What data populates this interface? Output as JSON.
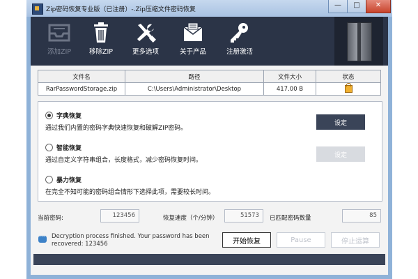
{
  "window": {
    "title": "Zip密码恢复专业版（已注册）-.Zip压缩文件密码恢复"
  },
  "toolbar": {
    "add_label": "添加ZIP",
    "remove_label": "移除ZIP",
    "options_label": "更多选项",
    "about_label": "关于产品",
    "register_label": "注册激活"
  },
  "table": {
    "headers": [
      "文件名",
      "路径",
      "文件大小",
      "状态"
    ],
    "rows": [
      {
        "name": "RarPasswordStorage.zip",
        "path": "C:\\Users\\Administrator\\Desktop",
        "size": "417.00 B",
        "status_icon": "lock-icon"
      }
    ]
  },
  "options": {
    "dict": {
      "title": "字典恢复",
      "desc": "通过我们内置的密码字典快速恢复和破解ZIP密码。",
      "selected": true,
      "button": "设定"
    },
    "smart": {
      "title": "智能恢复",
      "desc": "通过自定义字符串组合，长度格式，减少密码恢复时间。",
      "selected": false,
      "button": "设定"
    },
    "brute": {
      "title": "暴力恢复",
      "desc": "在完全不知可能的密码组合情形下选择此项，需要较长时间。",
      "selected": false
    }
  },
  "stats": {
    "current_label": "当前密码:",
    "current_value": "123456",
    "speed_label": "恢复速度（个/分钟）",
    "speed_value": "51573",
    "matched_label": "已匹配密码数量",
    "matched_value": "85"
  },
  "status": {
    "message": "Decryption process finished. Your password has been recovered: 123456"
  },
  "actions": {
    "start": "开始恢复",
    "pause": "Pause",
    "stop": "停止运算"
  },
  "progress": {
    "fraction": 1.0
  },
  "colors": {
    "toolbar_bg": "#2b3447",
    "accent": "#3a4458",
    "progress_fill": "#5d7fb8"
  }
}
